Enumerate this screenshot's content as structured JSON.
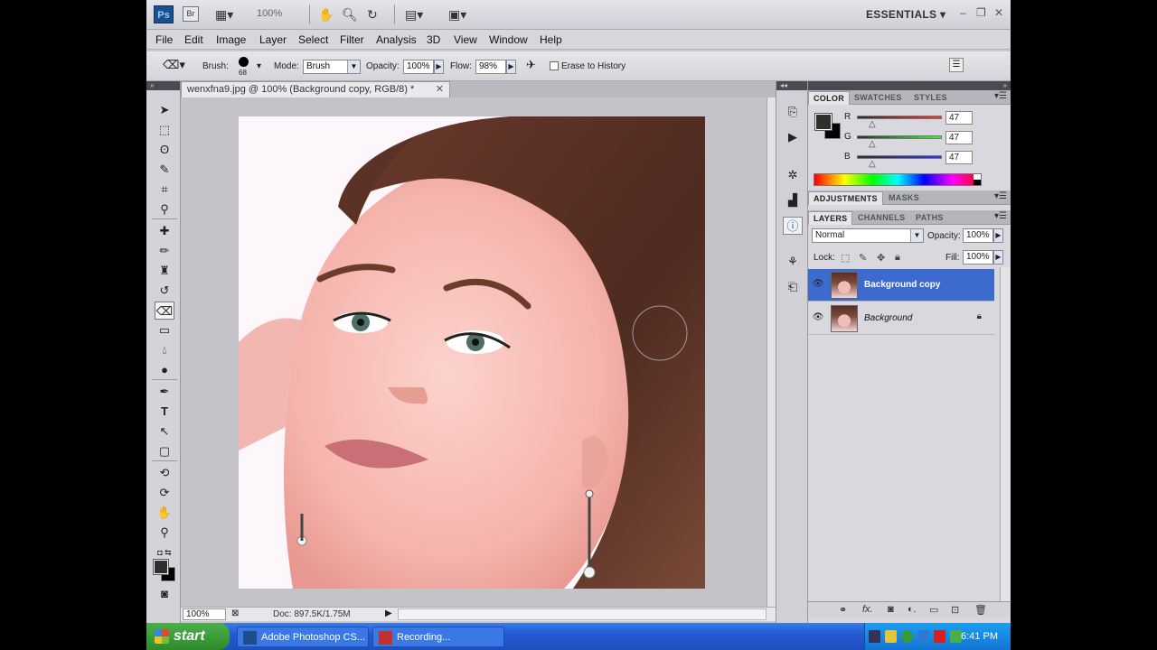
{
  "app": {
    "logo": "Ps",
    "bridge": "Br",
    "zoom_display": "100%",
    "workspace": "ESSENTIALS"
  },
  "menu": [
    "File",
    "Edit",
    "Image",
    "Layer",
    "Select",
    "Filter",
    "Analysis",
    "3D",
    "View",
    "Window",
    "Help"
  ],
  "options": {
    "brush_label": "Brush:",
    "brush_size": "68",
    "mode_label": "Mode:",
    "mode_value": "Brush",
    "opacity_label": "Opacity:",
    "opacity_value": "100%",
    "flow_label": "Flow:",
    "flow_value": "98%",
    "erase_history_label": "Erase to History"
  },
  "document": {
    "tab_title": "wenxfna9.jpg @ 100% (Background copy, RGB/8) *",
    "zoom": "100%",
    "doc_info": "Doc: 897.5K/1.75M"
  },
  "color_panel": {
    "tabs": [
      "COLOR",
      "SWATCHES",
      "STYLES"
    ],
    "channels": [
      {
        "name": "R",
        "value": "47"
      },
      {
        "name": "G",
        "value": "47"
      },
      {
        "name": "B",
        "value": "47"
      }
    ],
    "foreground": "#2f2f2f",
    "background": "#000000"
  },
  "adjustments_panel": {
    "tabs": [
      "ADJUSTMENTS",
      "MASKS"
    ]
  },
  "layers_panel": {
    "tabs": [
      "LAYERS",
      "CHANNELS",
      "PATHS"
    ],
    "blend_mode": "Normal",
    "opacity_label": "Opacity:",
    "opacity_value": "100%",
    "lock_label": "Lock:",
    "fill_label": "Fill:",
    "fill_value": "100%",
    "layers": [
      {
        "name": "Background copy",
        "selected": true,
        "locked": false
      },
      {
        "name": "Background",
        "selected": false,
        "locked": true
      }
    ]
  },
  "taskbar": {
    "start": "start",
    "tasks": [
      "Adobe Photoshop CS...",
      "Recording..."
    ],
    "clock": "6:41 PM"
  }
}
